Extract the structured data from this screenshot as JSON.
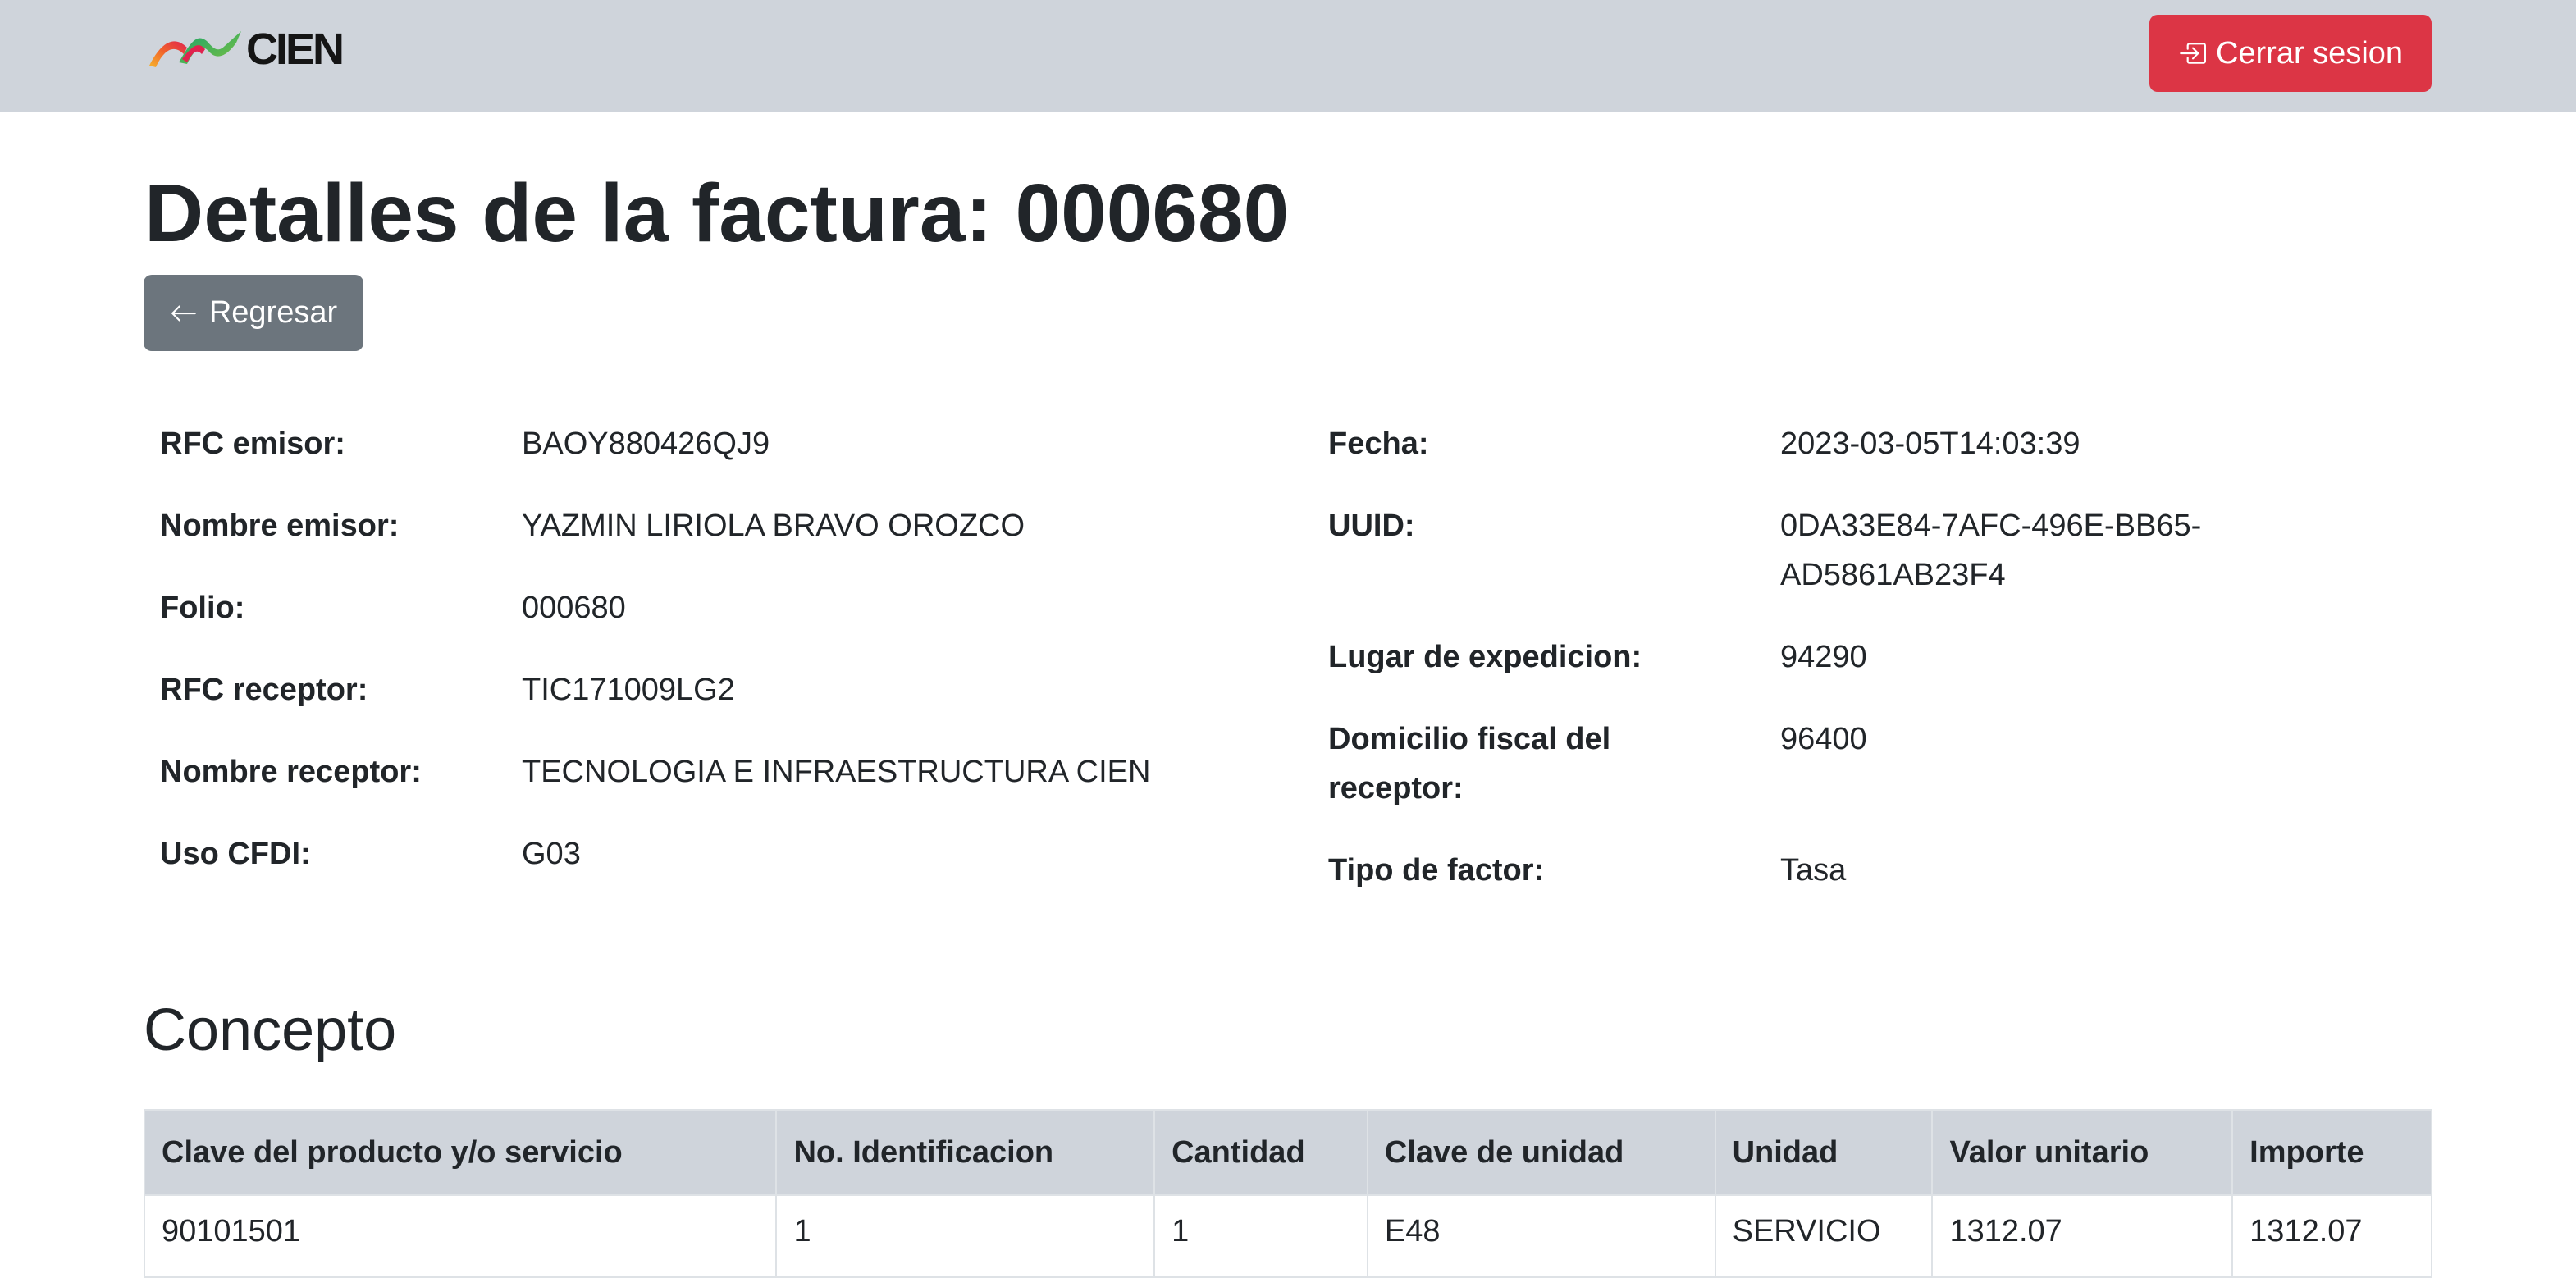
{
  "brand": {
    "name": "CIEN"
  },
  "header": {
    "logout_label": "Cerrar sesion"
  },
  "page": {
    "title": "Detalles de la factura: 000680",
    "back_label": "Regresar"
  },
  "details_left": [
    {
      "label": "RFC emisor:",
      "value": "BAOY880426QJ9"
    },
    {
      "label": "Nombre emisor:",
      "value": "YAZMIN LIRIOLA BRAVO OROZCO"
    },
    {
      "label": "Folio:",
      "value": "000680"
    },
    {
      "label": "RFC receptor:",
      "value": "TIC171009LG2"
    },
    {
      "label": "Nombre receptor:",
      "value": "TECNOLOGIA E INFRAESTRUCTURA CIEN"
    },
    {
      "label": "Uso CFDI:",
      "value": "G03"
    }
  ],
  "details_right": [
    {
      "label": "Fecha:",
      "value": "2023-03-05T14:03:39"
    },
    {
      "label": "UUID:",
      "value_line1": "0DA33E84-7AFC-496E-BB65-",
      "value_line2": "AD5861AB23F4"
    },
    {
      "label": "Lugar de expedicion:",
      "value": "94290"
    },
    {
      "label_line1": "Domicilio fiscal del",
      "label_line2": "receptor:",
      "value": "96400"
    },
    {
      "label": "Tipo de factor:",
      "value": "Tasa"
    }
  ],
  "concepto": {
    "title": "Concepto",
    "columns": [
      "Clave del producto y/o servicio",
      "No. Identificacion",
      "Cantidad",
      "Clave de unidad",
      "Unidad",
      "Valor unitario",
      "Importe"
    ],
    "rows": [
      [
        "90101501",
        "1",
        "1",
        "E48",
        "SERVICIO",
        "1312.07",
        "1312.07"
      ]
    ]
  },
  "colors": {
    "navbar_bg": "#cfd4db",
    "danger": "#dc3545",
    "secondary": "#6c757d",
    "text": "#212529",
    "link": "#0d6efd"
  },
  "icons": {
    "logout": "box-arrow-in-left-icon",
    "back": "arrow-left-icon",
    "logo": "cien-logo-mark"
  }
}
